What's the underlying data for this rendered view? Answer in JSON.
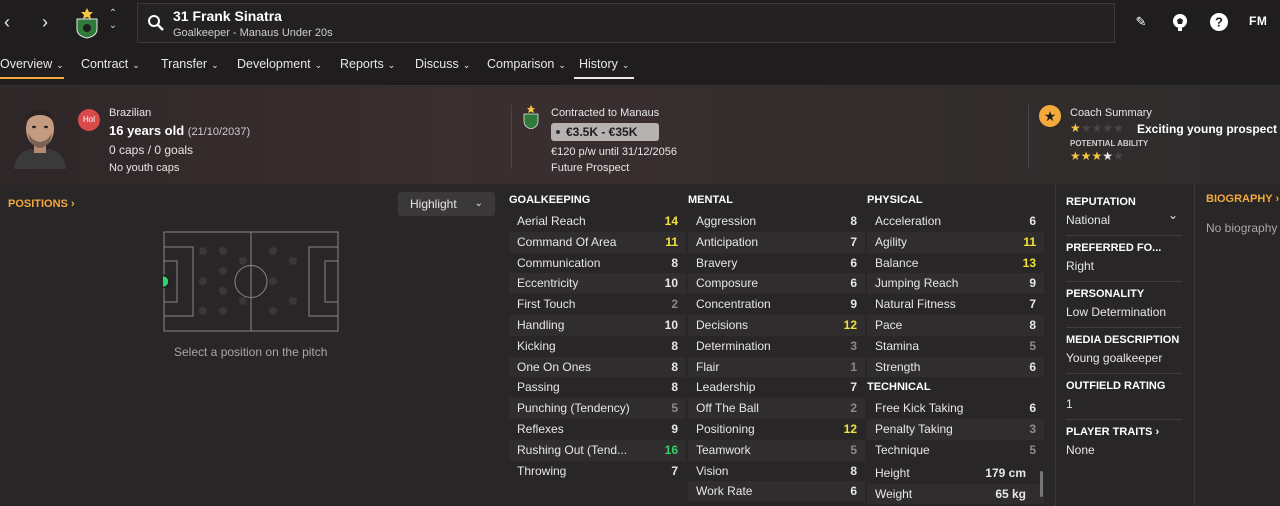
{
  "header": {
    "player_title": "31 Frank Sinatra",
    "player_subtitle": "Goalkeeper - Manaus Under 20s",
    "logo_text": "FM"
  },
  "tabs": [
    {
      "label": "Overview"
    },
    {
      "label": "Contract"
    },
    {
      "label": "Transfer"
    },
    {
      "label": "Development"
    },
    {
      "label": "Reports"
    },
    {
      "label": "Discuss"
    },
    {
      "label": "Comparison"
    },
    {
      "label": "History"
    }
  ],
  "profile": {
    "flag_badge": "Hol",
    "nationality": "Brazilian",
    "age": "16 years old",
    "dob": "(21/10/2037)",
    "caps": "0 caps / 0 goals",
    "youth_caps": "No youth caps"
  },
  "contract": {
    "title": "Contracted to Manaus",
    "value_range": "€3.5K - €35K",
    "wage": "€120 p/w until 31/12/2056",
    "status": "Future Prospect"
  },
  "coach": {
    "title": "Coach Summary",
    "current_ability_stars": 1,
    "verdict": "Exciting young prospect",
    "pa_label": "POTENTIAL ABILITY",
    "potential_ability_stars": 3.5
  },
  "positions": {
    "title": "POSITIONS",
    "highlight_label": "Highlight",
    "hint": "Select a position on the pitch"
  },
  "attributes": {
    "goalkeeping": {
      "title": "GOALKEEPING",
      "rows": [
        {
          "name": "Aerial Reach",
          "value": "14"
        },
        {
          "name": "Command Of Area",
          "value": "11"
        },
        {
          "name": "Communication",
          "value": "8"
        },
        {
          "name": "Eccentricity",
          "value": "10"
        },
        {
          "name": "First Touch",
          "value": "2"
        },
        {
          "name": "Handling",
          "value": "10"
        },
        {
          "name": "Kicking",
          "value": "8"
        },
        {
          "name": "One On Ones",
          "value": "8"
        },
        {
          "name": "Passing",
          "value": "8"
        },
        {
          "name": "Punching (Tendency)",
          "value": "5"
        },
        {
          "name": "Reflexes",
          "value": "9"
        },
        {
          "name": "Rushing Out (Tend...",
          "value": "16"
        },
        {
          "name": "Throwing",
          "value": "7"
        }
      ]
    },
    "mental": {
      "title": "MENTAL",
      "rows": [
        {
          "name": "Aggression",
          "value": "8"
        },
        {
          "name": "Anticipation",
          "value": "7"
        },
        {
          "name": "Bravery",
          "value": "6"
        },
        {
          "name": "Composure",
          "value": "6"
        },
        {
          "name": "Concentration",
          "value": "9"
        },
        {
          "name": "Decisions",
          "value": "12"
        },
        {
          "name": "Determination",
          "value": "3"
        },
        {
          "name": "Flair",
          "value": "1"
        },
        {
          "name": "Leadership",
          "value": "7"
        },
        {
          "name": "Off The Ball",
          "value": "2"
        },
        {
          "name": "Positioning",
          "value": "12"
        },
        {
          "name": "Teamwork",
          "value": "5"
        },
        {
          "name": "Vision",
          "value": "8"
        },
        {
          "name": "Work Rate",
          "value": "6"
        }
      ]
    },
    "physical": {
      "title": "PHYSICAL",
      "rows": [
        {
          "name": "Acceleration",
          "value": "6"
        },
        {
          "name": "Agility",
          "value": "11"
        },
        {
          "name": "Balance",
          "value": "13"
        },
        {
          "name": "Jumping Reach",
          "value": "9"
        },
        {
          "name": "Natural Fitness",
          "value": "7"
        },
        {
          "name": "Pace",
          "value": "8"
        },
        {
          "name": "Stamina",
          "value": "5"
        },
        {
          "name": "Strength",
          "value": "6"
        }
      ]
    },
    "technical": {
      "title": "TECHNICAL",
      "rows": [
        {
          "name": "Free Kick Taking",
          "value": "6"
        },
        {
          "name": "Penalty Taking",
          "value": "3"
        },
        {
          "name": "Technique",
          "value": "5"
        }
      ]
    },
    "body": [
      {
        "name": "Height",
        "value": "179 cm"
      },
      {
        "name": "Weight",
        "value": "65 kg"
      }
    ]
  },
  "side": {
    "reputation_label": "REPUTATION",
    "reputation_value": "National",
    "foot_label": "PREFERRED FO...",
    "foot_value": "Right",
    "personality_label": "PERSONALITY",
    "personality_value": "Low Determination",
    "media_label": "MEDIA DESCRIPTION",
    "media_value": "Young goalkeeper",
    "outfield_label": "OUTFIELD RATING",
    "outfield_value": "1",
    "traits_label": "PLAYER TRAITS",
    "traits_value": "None"
  },
  "biography": {
    "title": "BIOGRAPHY",
    "text": "No biography"
  },
  "colors": {
    "accent": "#f4a93c",
    "high_value": "#f2e23a",
    "top_value": "#35d06a",
    "low_value": "#8e8a8a"
  },
  "icons": [
    "back-arrow-icon",
    "forward-arrow-icon",
    "search-icon",
    "pencil-icon",
    "football-icon",
    "help-icon",
    "star-icon",
    "chevron-down-icon",
    "chevron-right-icon"
  ]
}
